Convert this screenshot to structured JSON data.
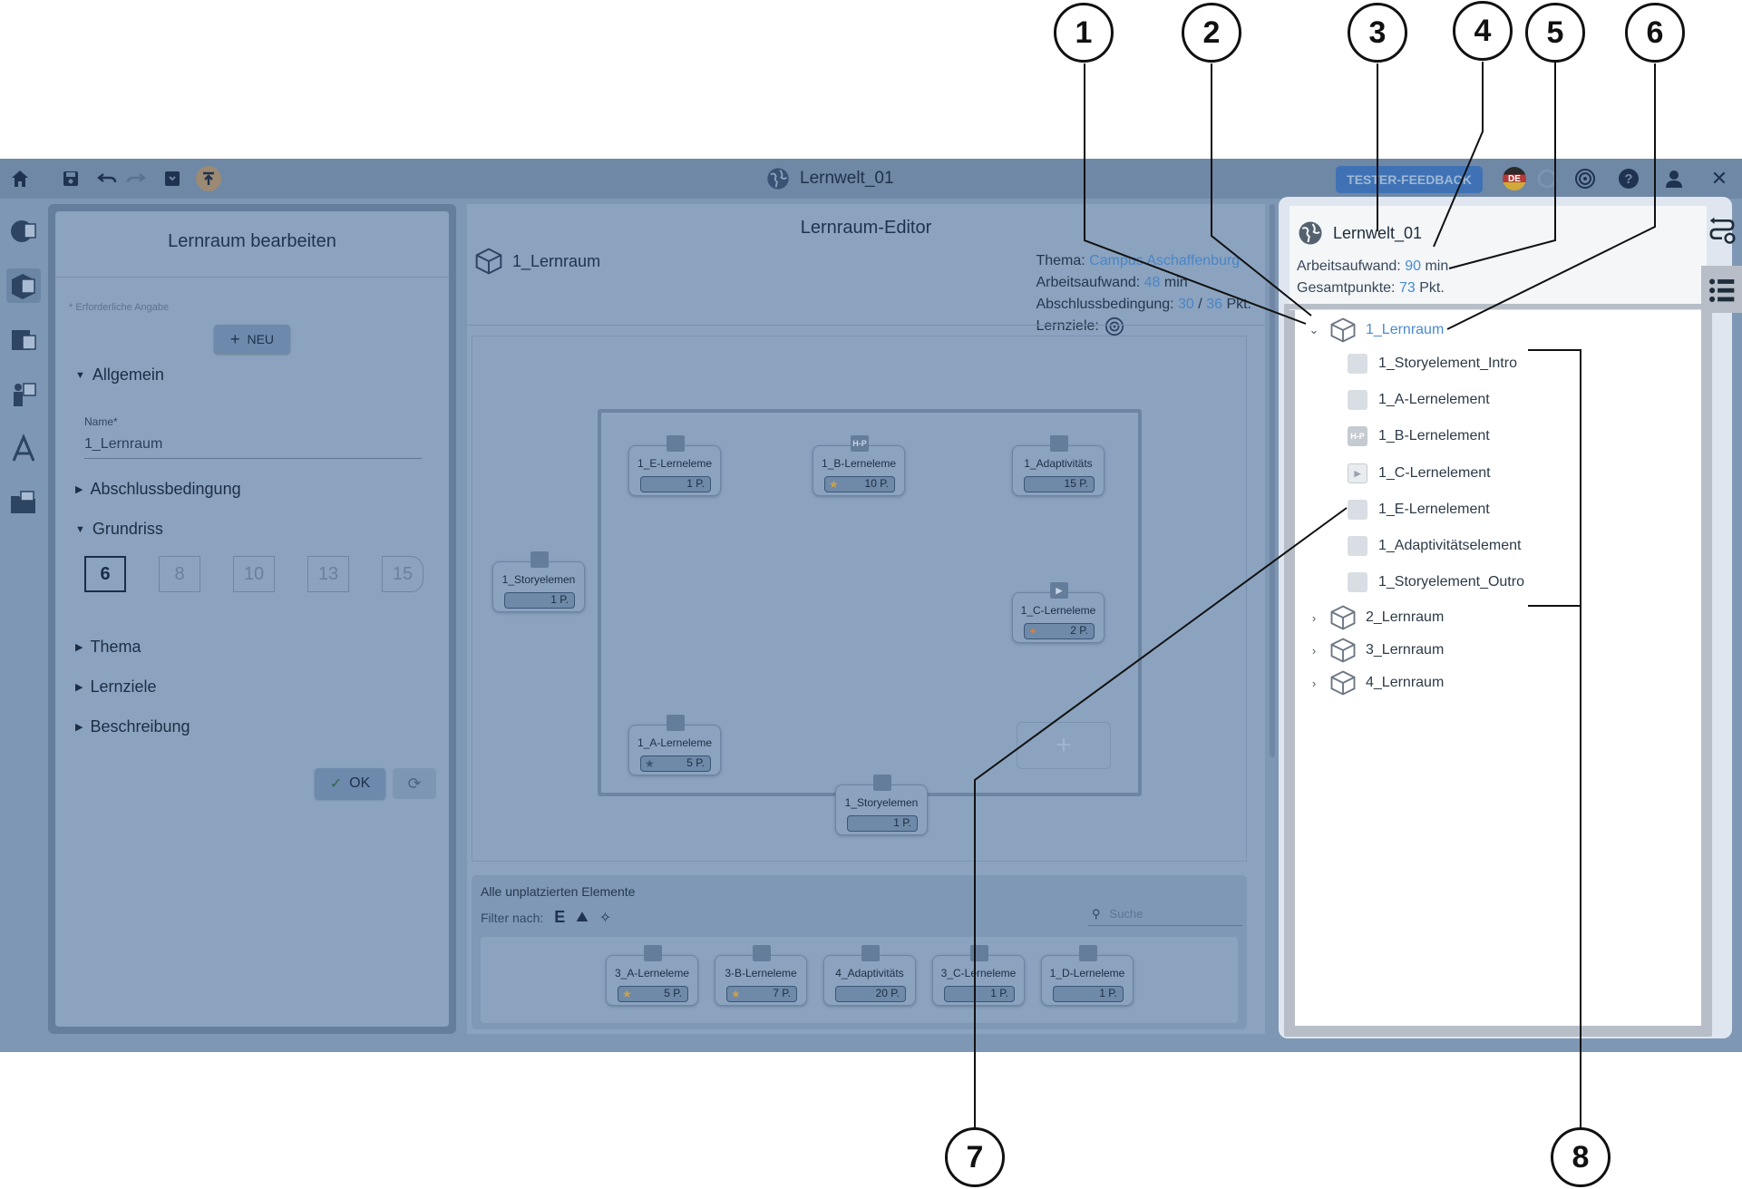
{
  "toolbar": {
    "world_title": "Lernwelt_01",
    "feedback_label": "TESTER-FEEDBACK",
    "language": "DE",
    "close_glyph": "✕"
  },
  "edit_panel": {
    "title": "Lernraum bearbeiten",
    "required_note": "* Erforderliche Angabe",
    "new_button": "NEU",
    "sections": {
      "general": "Allgemein",
      "completion": "Abschlussbedingung",
      "floorplan": "Grundriss",
      "theme": "Thema",
      "goals": "Lernziele",
      "description": "Beschreibung"
    },
    "name_label": "Name*",
    "name_value": "1_Lernraum",
    "floorplan_sizes": [
      "6",
      "8",
      "10",
      "13",
      "15"
    ],
    "selected_floorplan": "6",
    "ok_button": "OK"
  },
  "editor": {
    "title": "Lernraum-Editor",
    "room_name": "1_Lernraum",
    "meta": {
      "theme_label": "Thema:",
      "theme_value": "Campus Aschaffenburg",
      "workload_label": "Arbeitsaufwand:",
      "workload_value": "48",
      "workload_unit": "min",
      "completion_label": "Abschlussbedingung:",
      "completion_value": "30",
      "completion_sep": "/",
      "completion_total": "36",
      "completion_unit": "Pkt.",
      "goals_label": "Lernziele:"
    },
    "placed_elements": [
      {
        "name": "1_E-Lerneleme",
        "points": "1 P.",
        "icon": "image-icon",
        "star": false
      },
      {
        "name": "1_B-Lerneleme",
        "points": "10 P.",
        "icon": "h5p-icon",
        "star": true
      },
      {
        "name": "1_Adaptivitäts",
        "points": "15 P.",
        "icon": "adaptivity-icon",
        "star": false
      },
      {
        "name": "1_Storyelemen",
        "points": "1 P.",
        "icon": "story-icon",
        "star": false
      },
      {
        "name": "1_C-Lerneleme",
        "points": "2 P.",
        "icon": "video-icon",
        "star": true
      },
      {
        "name": "1_A-Lerneleme",
        "points": "5 P.",
        "icon": "text-icon",
        "star": true
      },
      {
        "name": "1_Storyelemen",
        "points": "1 P.",
        "icon": "story-icon",
        "star": false
      }
    ],
    "unplaced": {
      "title": "Alle unplatzierten Elemente",
      "filter_label": "Filter nach:",
      "filter_e": "E",
      "search_placeholder": "Suche",
      "elements": [
        {
          "name": "3_A-Lerneleme",
          "points": "5 P.",
          "star": true
        },
        {
          "name": "3-B-Lerneleme",
          "points": "7 P.",
          "star": true
        },
        {
          "name": "4_Adaptivitäts",
          "points": "20 P.",
          "star": false
        },
        {
          "name": "3_C-Lerneleme",
          "points": "1 P.",
          "star": false
        },
        {
          "name": "1_D-Lerneleme",
          "points": "1 P.",
          "star": false
        }
      ]
    }
  },
  "outline": {
    "world_title": "Lernwelt_01",
    "workload_label": "Arbeitsaufwand:",
    "workload_value": "90",
    "workload_unit": "min",
    "points_label": "Gesamtpunkte:",
    "points_value": "73",
    "points_unit": "Pkt.",
    "rooms": [
      {
        "label": "1_Lernraum",
        "expanded": true,
        "elements": [
          {
            "label": "1_Storyelement_Intro",
            "icon": "story-icon",
            "icon_text": ""
          },
          {
            "label": "1_A-Lernelement",
            "icon": "text-icon",
            "icon_text": ""
          },
          {
            "label": "1_B-Lernelement",
            "icon": "h5p-icon",
            "icon_text": "H-P"
          },
          {
            "label": "1_C-Lernelement",
            "icon": "video-icon",
            "icon_text": "▶"
          },
          {
            "label": "1_E-Lernelement",
            "icon": "image-icon",
            "icon_text": ""
          },
          {
            "label": "1_Adaptivitätselement",
            "icon": "adaptivity-icon",
            "icon_text": ""
          },
          {
            "label": "1_Storyelement_Outro",
            "icon": "story-icon",
            "icon_text": ""
          }
        ]
      },
      {
        "label": "2_Lernraum",
        "expanded": false
      },
      {
        "label": "3_Lernraum",
        "expanded": false
      },
      {
        "label": "4_Lernraum",
        "expanded": false
      }
    ]
  },
  "callouts": [
    "1",
    "2",
    "3",
    "4",
    "5",
    "6",
    "7",
    "8"
  ],
  "colors": {
    "overlay": "#7e97b4",
    "accent": "#4a8ad0",
    "feedback_button": "#3f72b5"
  }
}
